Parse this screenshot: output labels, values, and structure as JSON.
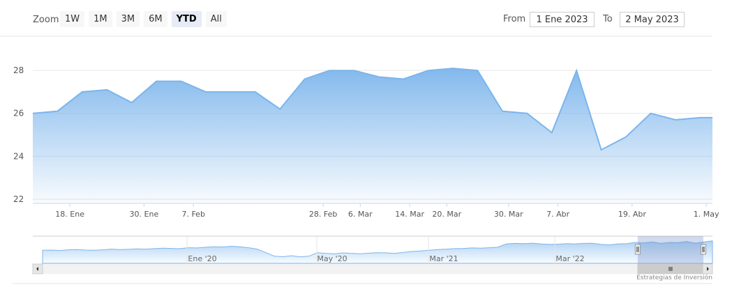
{
  "range_selector": {
    "zoom_label": "Zoom",
    "buttons": [
      "1W",
      "1M",
      "3M",
      "6M",
      "YTD",
      "All"
    ],
    "selected": "YTD",
    "from_label": "From",
    "from_value": "1 Ene 2023",
    "to_label": "To",
    "to_value": "2 May 2023"
  },
  "credit": "Estrategias de Inversión",
  "colors": {
    "line": "#7cb5ec",
    "fill_top": "#7cb5ec",
    "grid": "#e6e6e6",
    "navigator_mask": "#6685c2"
  },
  "chart_data": {
    "type": "area",
    "y_ticks": [
      22,
      24,
      26,
      28
    ],
    "ylim": [
      21.8,
      29.5
    ],
    "x_ticks": [
      {
        "label": "18. Ene",
        "date": "2023-01-18"
      },
      {
        "label": "30. Ene",
        "date": "2023-01-30"
      },
      {
        "label": "7. Feb",
        "date": "2023-02-07"
      },
      {
        "label": "28. Feb",
        "date": "2023-02-28"
      },
      {
        "label": "6. Mar",
        "date": "2023-03-06"
      },
      {
        "label": "14. Mar",
        "date": "2023-03-14"
      },
      {
        "label": "20. Mar",
        "date": "2023-03-20"
      },
      {
        "label": "30. Mar",
        "date": "2023-03-30"
      },
      {
        "label": "7. Abr",
        "date": "2023-04-07"
      },
      {
        "label": "19. Abr",
        "date": "2023-04-19"
      },
      {
        "label": "1. May",
        "date": "2023-05-01"
      }
    ],
    "xlim": [
      "2023-01-12",
      "2023-05-02"
    ],
    "series": [
      {
        "values": [
          {
            "x": "2023-01-12",
            "y": 26.0
          },
          {
            "x": "2023-01-16",
            "y": 26.1
          },
          {
            "x": "2023-01-20",
            "y": 27.0
          },
          {
            "x": "2023-01-24",
            "y": 27.1
          },
          {
            "x": "2023-01-28",
            "y": 26.5
          },
          {
            "x": "2023-02-01",
            "y": 27.5
          },
          {
            "x": "2023-02-05",
            "y": 27.5
          },
          {
            "x": "2023-02-09",
            "y": 27.0
          },
          {
            "x": "2023-02-13",
            "y": 27.0
          },
          {
            "x": "2023-02-17",
            "y": 27.0
          },
          {
            "x": "2023-02-21",
            "y": 26.2
          },
          {
            "x": "2023-02-25",
            "y": 27.6
          },
          {
            "x": "2023-03-01",
            "y": 28.0
          },
          {
            "x": "2023-03-05",
            "y": 28.0
          },
          {
            "x": "2023-03-09",
            "y": 27.7
          },
          {
            "x": "2023-03-13",
            "y": 27.6
          },
          {
            "x": "2023-03-17",
            "y": 28.0
          },
          {
            "x": "2023-03-21",
            "y": 28.1
          },
          {
            "x": "2023-03-25",
            "y": 28.0
          },
          {
            "x": "2023-03-29",
            "y": 26.1
          },
          {
            "x": "2023-04-02",
            "y": 26.0
          },
          {
            "x": "2023-04-06",
            "y": 25.1
          },
          {
            "x": "2023-04-10",
            "y": 28.0
          },
          {
            "x": "2023-04-14",
            "y": 24.3
          },
          {
            "x": "2023-04-18",
            "y": 24.9
          },
          {
            "x": "2023-04-22",
            "y": 26.0
          },
          {
            "x": "2023-04-26",
            "y": 25.7
          },
          {
            "x": "2023-04-30",
            "y": 25.8
          },
          {
            "x": "2023-05-02",
            "y": 25.8
          }
        ]
      }
    ],
    "grid": true,
    "navigator": {
      "labels": [
        "Ene '20",
        "May '20",
        "Mar '21",
        "Mar '22"
      ],
      "values": [
        0.55,
        0.56,
        0.54,
        0.57,
        0.58,
        0.56,
        0.55,
        0.57,
        0.6,
        0.58,
        0.59,
        0.61,
        0.6,
        0.62,
        0.64,
        0.63,
        0.62,
        0.66,
        0.65,
        0.68,
        0.7,
        0.69,
        0.72,
        0.7,
        0.66,
        0.6,
        0.45,
        0.3,
        0.28,
        0.32,
        0.27,
        0.3,
        0.45,
        0.42,
        0.4,
        0.44,
        0.42,
        0.4,
        0.43,
        0.45,
        0.44,
        0.42,
        0.46,
        0.5,
        0.52,
        0.55,
        0.58,
        0.6,
        0.62,
        0.63,
        0.65,
        0.64,
        0.66,
        0.68,
        0.82,
        0.84,
        0.83,
        0.85,
        0.82,
        0.8,
        0.81,
        0.83,
        0.82,
        0.84,
        0.85,
        0.8,
        0.78,
        0.82,
        0.83,
        0.88,
        0.86,
        0.9,
        0.84,
        0.88,
        0.87,
        0.92,
        0.85,
        0.9,
        0.95
      ],
      "window": {
        "start": 0.89,
        "end": 1.0
      }
    }
  }
}
